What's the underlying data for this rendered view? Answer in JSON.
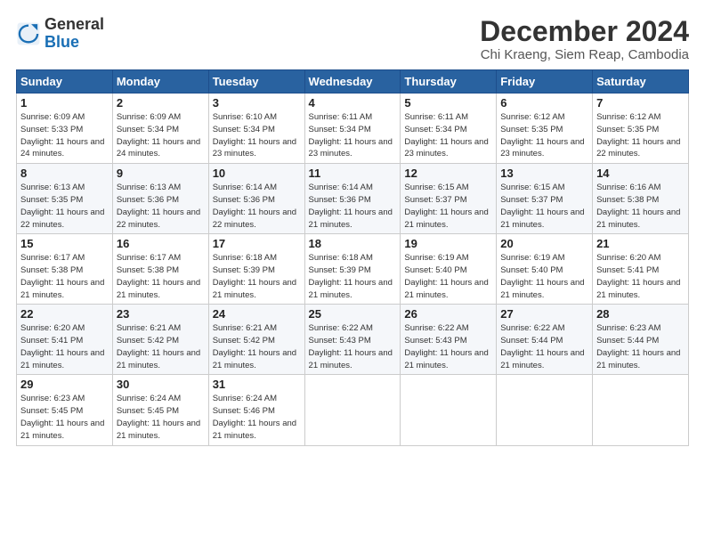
{
  "logo": {
    "general": "General",
    "blue": "Blue"
  },
  "title": {
    "month_year": "December 2024",
    "location": "Chi Kraeng, Siem Reap, Cambodia"
  },
  "days_of_week": [
    "Sunday",
    "Monday",
    "Tuesday",
    "Wednesday",
    "Thursday",
    "Friday",
    "Saturday"
  ],
  "weeks": [
    [
      {
        "day": "1",
        "sunrise": "6:09 AM",
        "sunset": "5:33 PM",
        "daylight": "11 hours and 24 minutes."
      },
      {
        "day": "2",
        "sunrise": "6:09 AM",
        "sunset": "5:34 PM",
        "daylight": "11 hours and 24 minutes."
      },
      {
        "day": "3",
        "sunrise": "6:10 AM",
        "sunset": "5:34 PM",
        "daylight": "11 hours and 23 minutes."
      },
      {
        "day": "4",
        "sunrise": "6:11 AM",
        "sunset": "5:34 PM",
        "daylight": "11 hours and 23 minutes."
      },
      {
        "day": "5",
        "sunrise": "6:11 AM",
        "sunset": "5:34 PM",
        "daylight": "11 hours and 23 minutes."
      },
      {
        "day": "6",
        "sunrise": "6:12 AM",
        "sunset": "5:35 PM",
        "daylight": "11 hours and 23 minutes."
      },
      {
        "day": "7",
        "sunrise": "6:12 AM",
        "sunset": "5:35 PM",
        "daylight": "11 hours and 22 minutes."
      }
    ],
    [
      {
        "day": "8",
        "sunrise": "6:13 AM",
        "sunset": "5:35 PM",
        "daylight": "11 hours and 22 minutes."
      },
      {
        "day": "9",
        "sunrise": "6:13 AM",
        "sunset": "5:36 PM",
        "daylight": "11 hours and 22 minutes."
      },
      {
        "day": "10",
        "sunrise": "6:14 AM",
        "sunset": "5:36 PM",
        "daylight": "11 hours and 22 minutes."
      },
      {
        "day": "11",
        "sunrise": "6:14 AM",
        "sunset": "5:36 PM",
        "daylight": "11 hours and 21 minutes."
      },
      {
        "day": "12",
        "sunrise": "6:15 AM",
        "sunset": "5:37 PM",
        "daylight": "11 hours and 21 minutes."
      },
      {
        "day": "13",
        "sunrise": "6:15 AM",
        "sunset": "5:37 PM",
        "daylight": "11 hours and 21 minutes."
      },
      {
        "day": "14",
        "sunrise": "6:16 AM",
        "sunset": "5:38 PM",
        "daylight": "11 hours and 21 minutes."
      }
    ],
    [
      {
        "day": "15",
        "sunrise": "6:17 AM",
        "sunset": "5:38 PM",
        "daylight": "11 hours and 21 minutes."
      },
      {
        "day": "16",
        "sunrise": "6:17 AM",
        "sunset": "5:38 PM",
        "daylight": "11 hours and 21 minutes."
      },
      {
        "day": "17",
        "sunrise": "6:18 AM",
        "sunset": "5:39 PM",
        "daylight": "11 hours and 21 minutes."
      },
      {
        "day": "18",
        "sunrise": "6:18 AM",
        "sunset": "5:39 PM",
        "daylight": "11 hours and 21 minutes."
      },
      {
        "day": "19",
        "sunrise": "6:19 AM",
        "sunset": "5:40 PM",
        "daylight": "11 hours and 21 minutes."
      },
      {
        "day": "20",
        "sunrise": "6:19 AM",
        "sunset": "5:40 PM",
        "daylight": "11 hours and 21 minutes."
      },
      {
        "day": "21",
        "sunrise": "6:20 AM",
        "sunset": "5:41 PM",
        "daylight": "11 hours and 21 minutes."
      }
    ],
    [
      {
        "day": "22",
        "sunrise": "6:20 AM",
        "sunset": "5:41 PM",
        "daylight": "11 hours and 21 minutes."
      },
      {
        "day": "23",
        "sunrise": "6:21 AM",
        "sunset": "5:42 PM",
        "daylight": "11 hours and 21 minutes."
      },
      {
        "day": "24",
        "sunrise": "6:21 AM",
        "sunset": "5:42 PM",
        "daylight": "11 hours and 21 minutes."
      },
      {
        "day": "25",
        "sunrise": "6:22 AM",
        "sunset": "5:43 PM",
        "daylight": "11 hours and 21 minutes."
      },
      {
        "day": "26",
        "sunrise": "6:22 AM",
        "sunset": "5:43 PM",
        "daylight": "11 hours and 21 minutes."
      },
      {
        "day": "27",
        "sunrise": "6:22 AM",
        "sunset": "5:44 PM",
        "daylight": "11 hours and 21 minutes."
      },
      {
        "day": "28",
        "sunrise": "6:23 AM",
        "sunset": "5:44 PM",
        "daylight": "11 hours and 21 minutes."
      }
    ],
    [
      {
        "day": "29",
        "sunrise": "6:23 AM",
        "sunset": "5:45 PM",
        "daylight": "11 hours and 21 minutes."
      },
      {
        "day": "30",
        "sunrise": "6:24 AM",
        "sunset": "5:45 PM",
        "daylight": "11 hours and 21 minutes."
      },
      {
        "day": "31",
        "sunrise": "6:24 AM",
        "sunset": "5:46 PM",
        "daylight": "11 hours and 21 minutes."
      },
      null,
      null,
      null,
      null
    ]
  ],
  "labels": {
    "sunrise": "Sunrise: ",
    "sunset": "Sunset: ",
    "daylight": "Daylight: "
  }
}
